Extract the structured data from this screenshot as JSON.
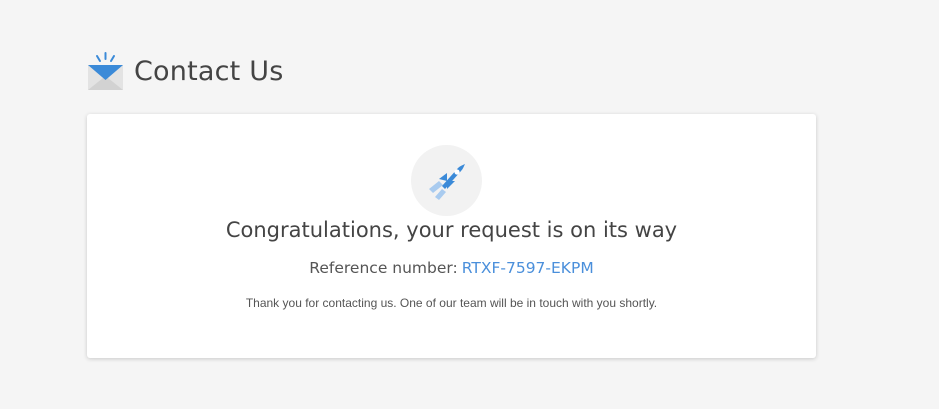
{
  "header": {
    "icon": "envelope-icon",
    "title": "Contact Us"
  },
  "confirmation": {
    "icon": "rocket-icon",
    "headline": "Congratulations, your request is on its way",
    "reference_label": "Reference number:",
    "reference_code": "RTXF-7597-EKPM",
    "message": "Thank you for contacting us. One of our team will be in touch with you shortly."
  },
  "colors": {
    "accent": "#4a8fdb",
    "background": "#f5f5f5",
    "card": "#ffffff",
    "text": "#444444"
  }
}
